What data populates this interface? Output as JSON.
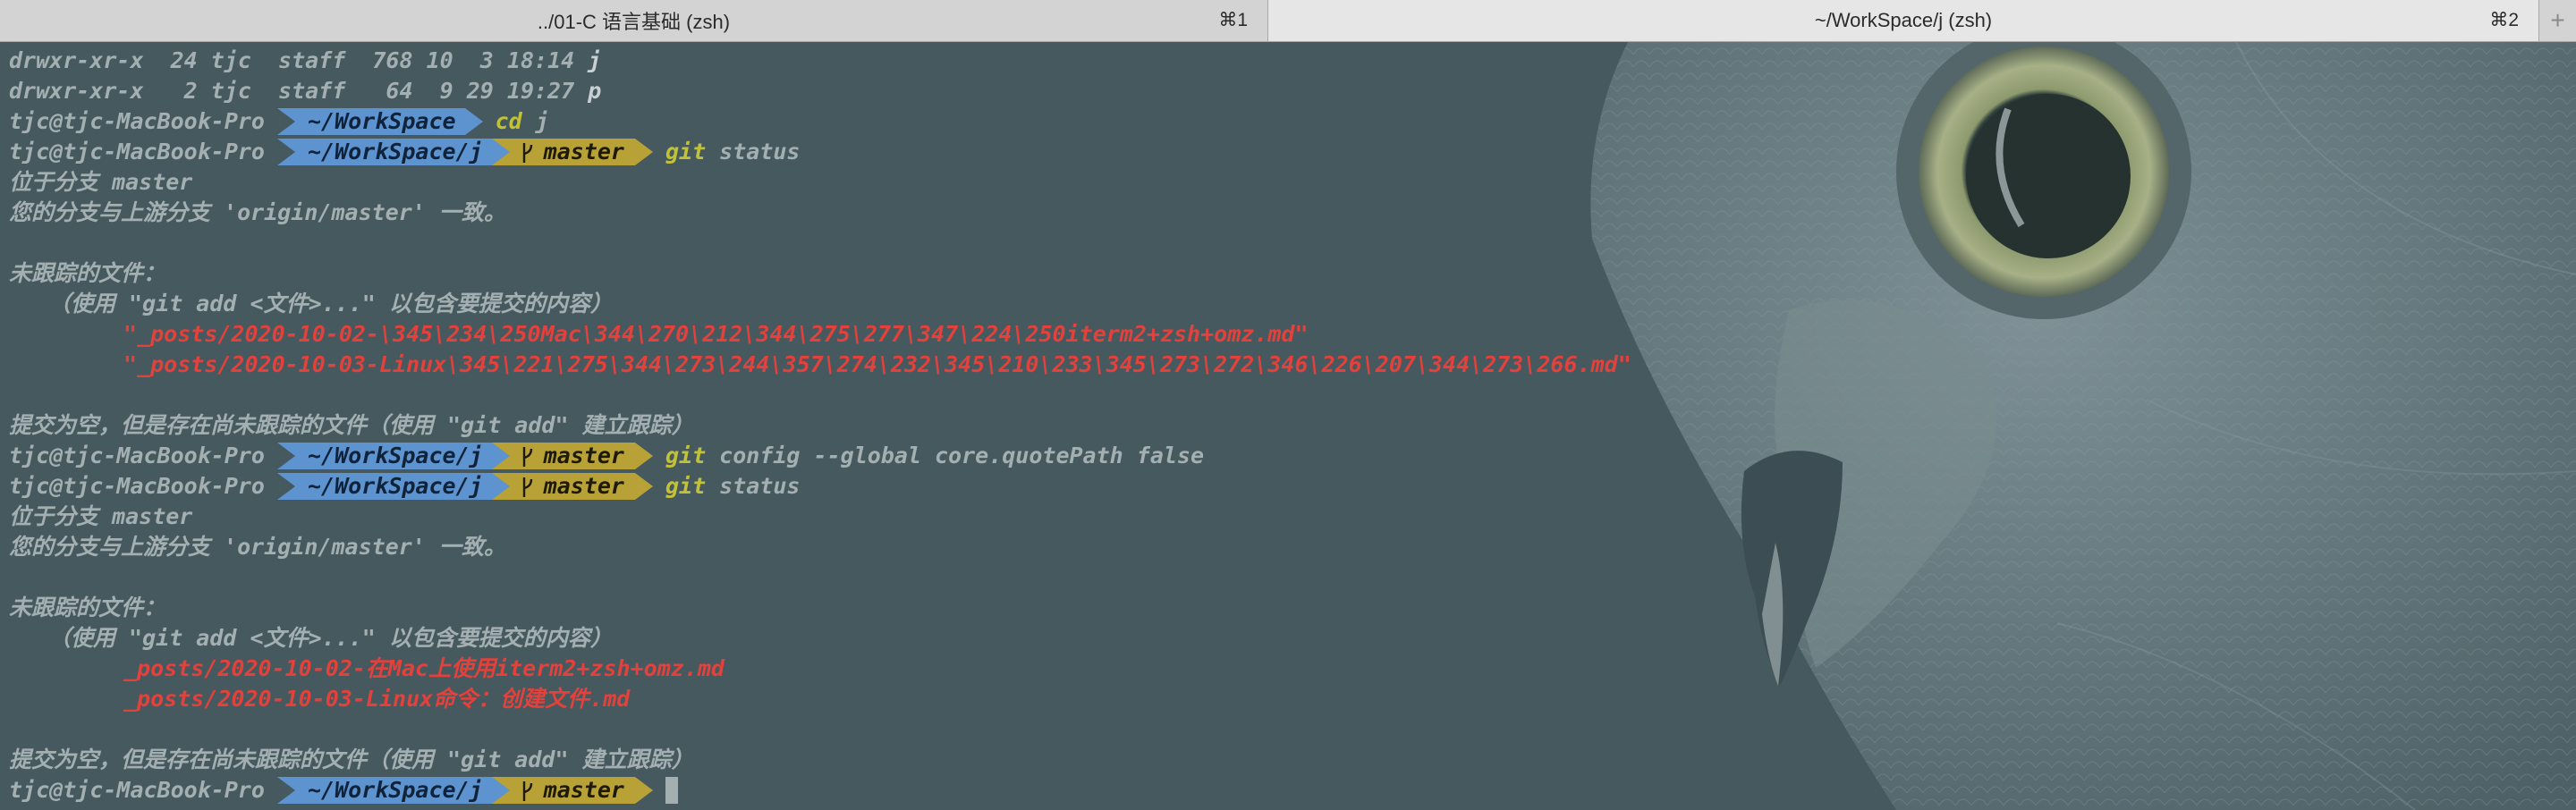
{
  "tabs": [
    {
      "title": "../01-C 语言基础 (zsh)",
      "shortcut": "⌘1",
      "active": false
    },
    {
      "title": "~/WorkSpace/j (zsh)",
      "shortcut": "⌘2",
      "active": true
    }
  ],
  "new_tab_label": "+",
  "prompt": {
    "context": "tjc@tjc-MacBook-Pro",
    "branch": "master",
    "colors": {
      "path_bg": "#5d93cf",
      "git_bg": "#b8a238",
      "command": "#c3c237",
      "untracked": "#e2413c"
    }
  },
  "lines": {
    "ls1": "drwxr-xr-x  24 tjc  staff  768 10  3 18:14 ",
    "ls1_name": "j",
    "ls2": "drwxr-xr-x   2 tjc  staff   64  9 29 19:27 ",
    "ls2_name": "p",
    "p1_path": "~/WorkSpace",
    "p1_cmd": "cd",
    "p1_arg": " j",
    "p2_path": "~/WorkSpace/j",
    "p2_cmd": "git",
    "p2_arg": " status",
    "s1_branch": "位于分支 master",
    "s1_uptodate": "您的分支与上游分支 'origin/master' 一致。",
    "s1_untracked_header": "未跟踪的文件：",
    "s1_hint": "（使用 \"git add <文件>...\" 以包含要提交的内容）",
    "s1_file1": "\"_posts/2020-10-02-\\345\\234\\250Mac\\344\\270\\212\\344\\275\\277\\347\\224\\250iterm2+zsh+omz.md\"",
    "s1_file2": "\"_posts/2020-10-03-Linux\\345\\221\\275\\344\\273\\244\\357\\274\\232\\345\\210\\233\\345\\273\\272\\346\\226\\207\\344\\273\\266.md\"",
    "s1_summary": "提交为空，但是存在尚未跟踪的文件（使用 \"git add\" 建立跟踪）",
    "p3_path": "~/WorkSpace/j",
    "p3_cmd": "git",
    "p3_arg": " config --global core.quotePath false",
    "p4_path": "~/WorkSpace/j",
    "p4_cmd": "git",
    "p4_arg": " status",
    "s2_branch": "位于分支 master",
    "s2_uptodate": "您的分支与上游分支 'origin/master' 一致。",
    "s2_untracked_header": "未跟踪的文件：",
    "s2_hint": "（使用 \"git add <文件>...\" 以包含要提交的内容）",
    "s2_file1": "_posts/2020-10-02-在Mac上使用iterm2+zsh+omz.md",
    "s2_file2": "_posts/2020-10-03-Linux命令：创建文件.md",
    "s2_summary": "提交为空，但是存在尚未跟踪的文件（使用 \"git add\" 建立跟踪）",
    "p5_path": "~/WorkSpace/j"
  }
}
